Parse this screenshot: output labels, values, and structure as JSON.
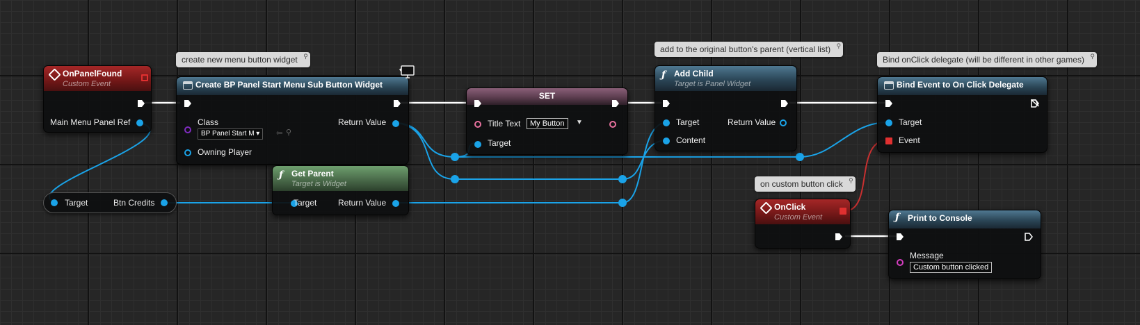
{
  "colors": {
    "exec": "#ffffff",
    "object_pin": "#1aa3e8",
    "class_pin": "#7f2cc0",
    "text_pin": "#e8719e",
    "string_pin": "#d53ec0",
    "delegate_pin": "#e03030",
    "wire_red": "#c83030"
  },
  "comments": {
    "create_widget": "create new menu button widget",
    "add_child": "add to the original button's parent (vertical list)",
    "bind_event": "Bind onClick delegate (will be different in other games)",
    "on_click": "on custom button click"
  },
  "nodes": {
    "on_panel_found": {
      "title": "OnPanelFound",
      "subtitle": "Custom Event",
      "pin_out": "Main Menu Panel Ref",
      "icon": "event-diamond-icon"
    },
    "create_widget": {
      "title": "Create BP Panel Start Menu Sub Button Widget",
      "pin_class": "Class",
      "class_value": "BP Panel Start M",
      "pin_owning_player": "Owning Player",
      "pin_return": "Return Value",
      "icon": "widget-class-icon"
    },
    "set_node": {
      "title": "SET",
      "pin_title_text": "Title Text",
      "title_text_value": "My Button",
      "pin_target": "Target"
    },
    "add_child": {
      "title": "Add Child",
      "subtitle": "Target is Panel Widget",
      "pin_target": "Target",
      "pin_content": "Content",
      "pin_return": "Return Value",
      "icon": "function-icon"
    },
    "bind_event": {
      "title": "Bind Event to On Click Delegate",
      "pin_target": "Target",
      "pin_event": "Event",
      "icon": "widget-class-icon"
    },
    "get_parent": {
      "title": "Get Parent",
      "subtitle": "Target is Widget",
      "pin_target": "Target",
      "pin_return": "Return Value",
      "icon": "function-icon"
    },
    "btn_credits": {
      "pin_target": "Target",
      "pin_out": "Btn Credits"
    },
    "on_click": {
      "title": "OnClick",
      "subtitle": "Custom Event",
      "icon": "event-diamond-icon"
    },
    "print_console": {
      "title": "Print to Console",
      "pin_message": "Message",
      "message_value": "Custom button clicked",
      "icon": "function-icon"
    }
  }
}
